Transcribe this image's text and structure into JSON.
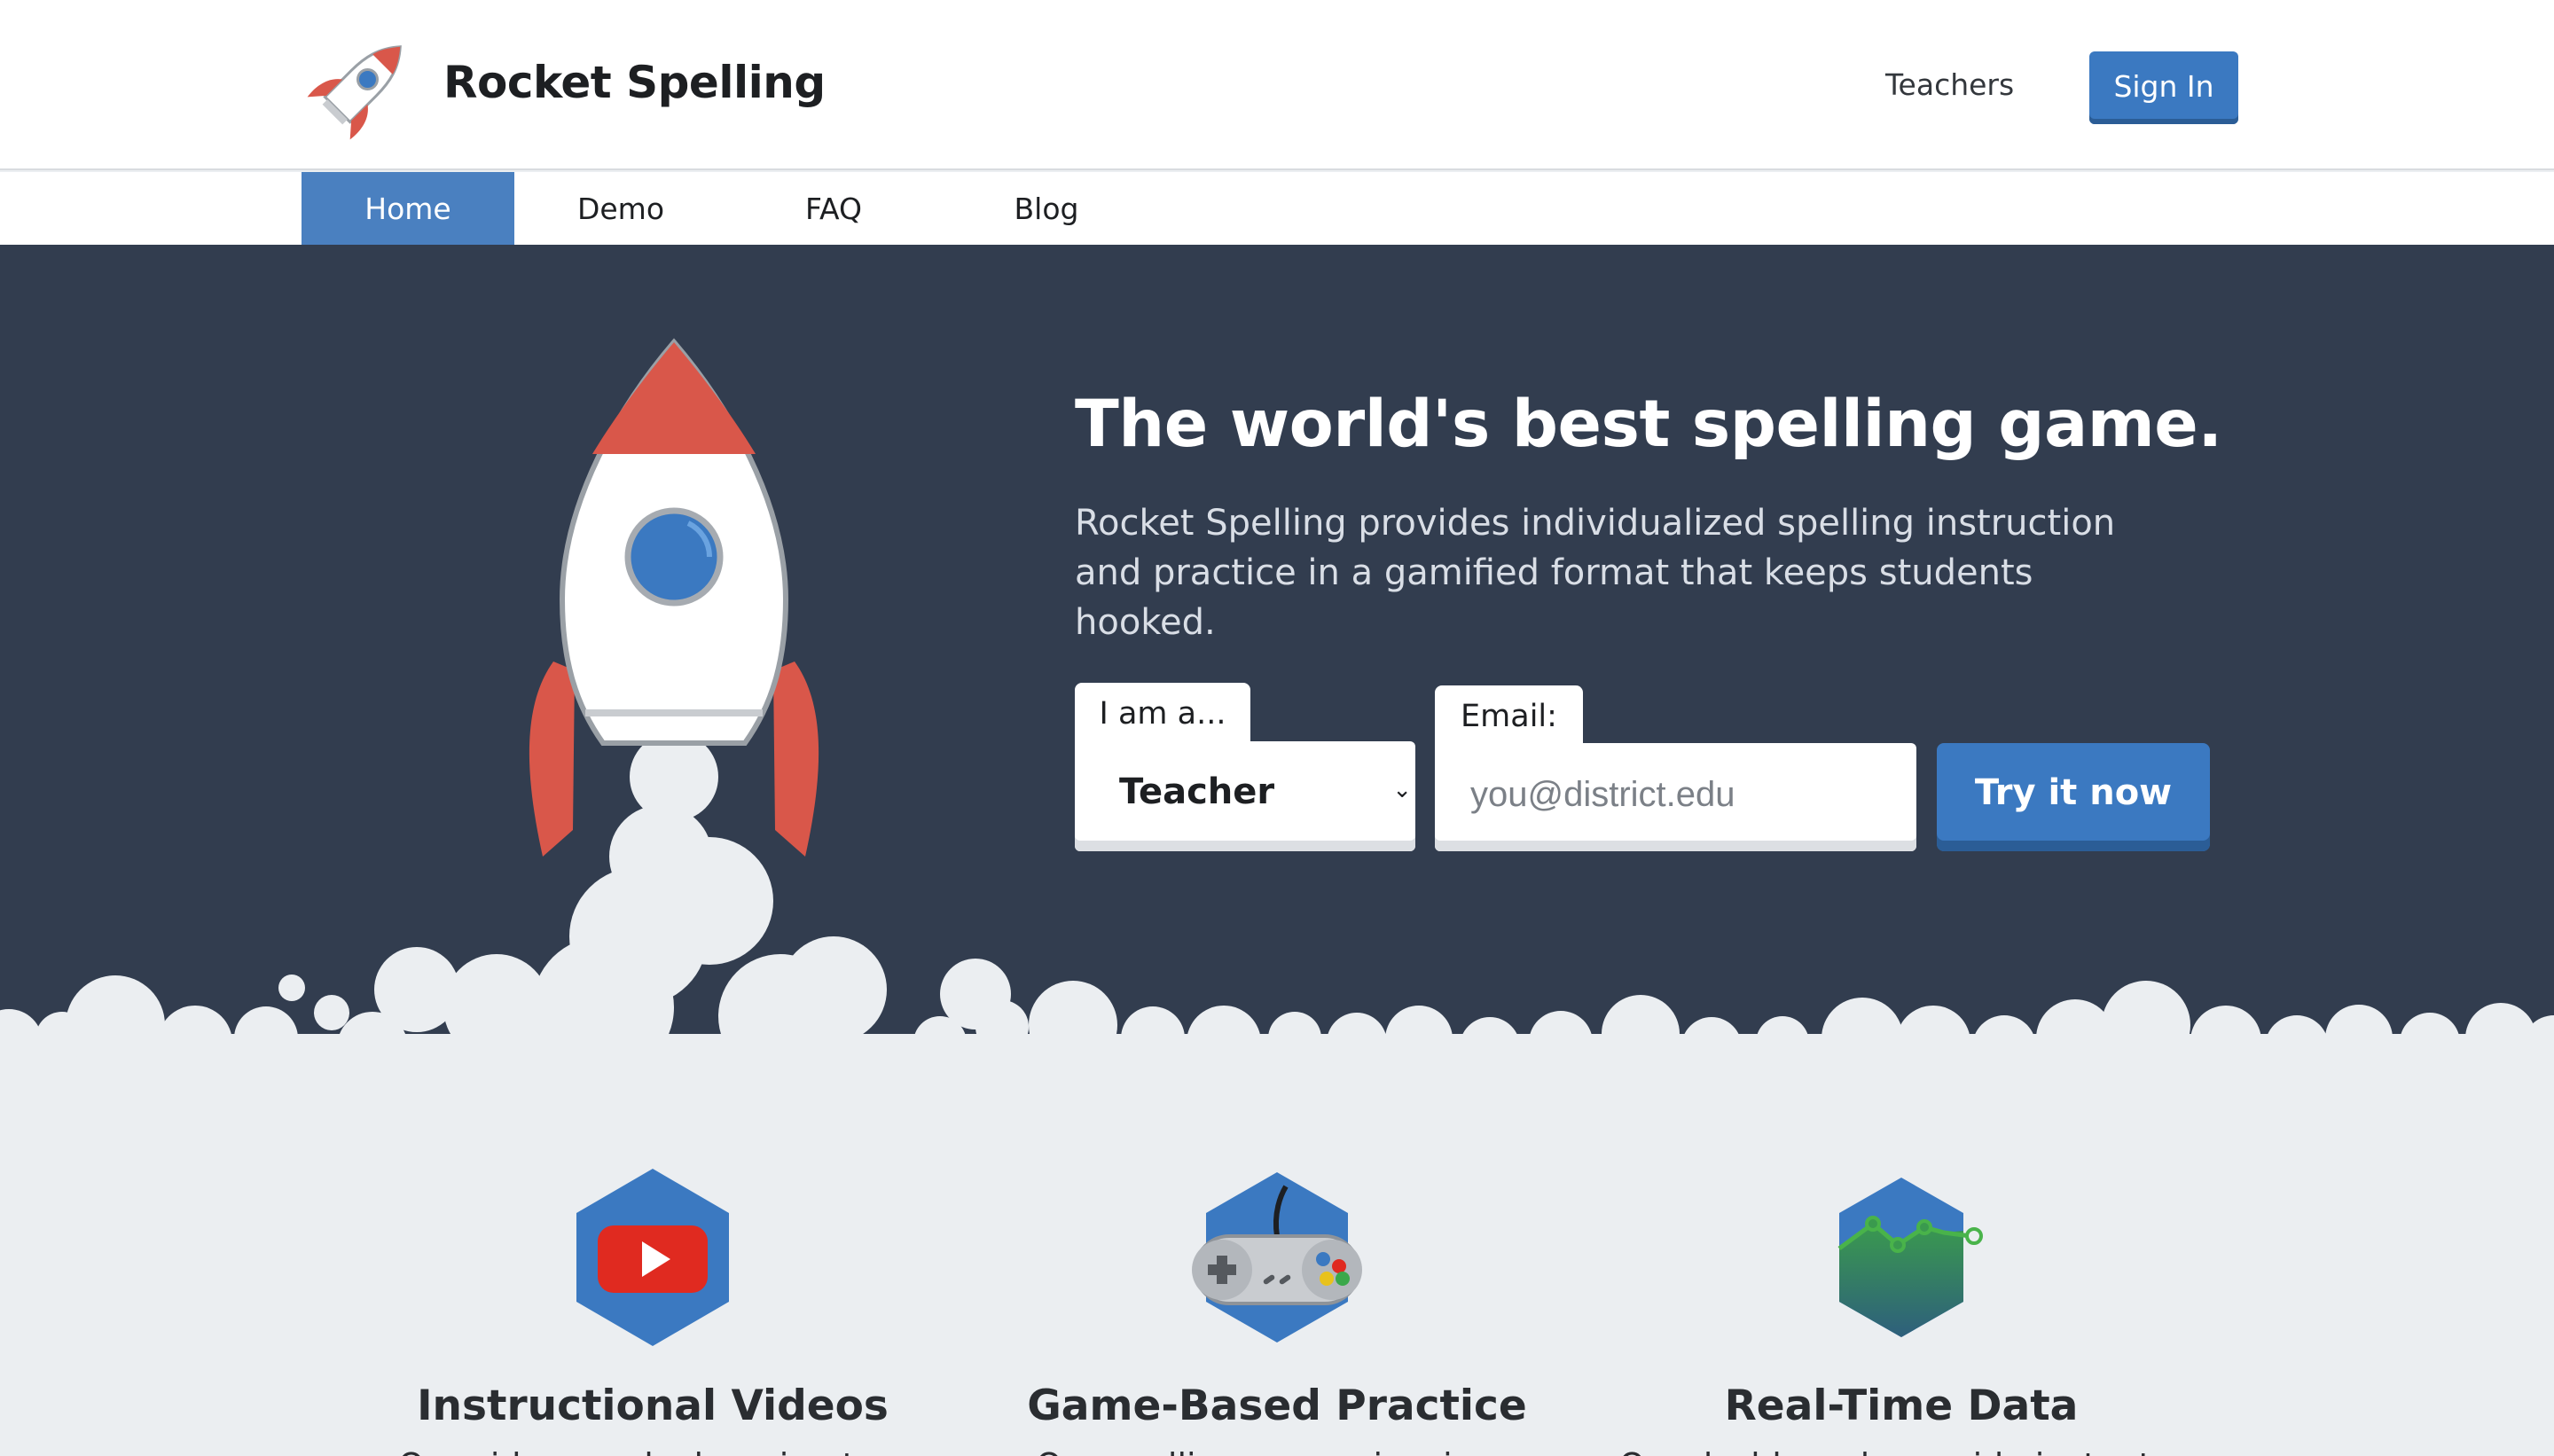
{
  "header": {
    "brand": "Rocket Spelling",
    "teachers_link": "Teachers",
    "signin_label": "Sign In"
  },
  "nav": {
    "items": [
      {
        "label": "Home",
        "active": true
      },
      {
        "label": "Demo",
        "active": false
      },
      {
        "label": "FAQ",
        "active": false
      },
      {
        "label": "Blog",
        "active": false
      }
    ]
  },
  "hero": {
    "headline": "The world's best spelling game.",
    "subtext": "Rocket Spelling provides individualized spelling instruction and practice in a gamified format that keeps students hooked.",
    "role_tab_label": "I am a...",
    "role_selected": "Teacher",
    "email_tab_label": "Email:",
    "email_placeholder": "you@district.edu",
    "cta_label": "Try it now"
  },
  "features": [
    {
      "title": "Instructional Videos",
      "desc": "Our videos make learning to...",
      "icon": "youtube-play-icon"
    },
    {
      "title": "Game-Based Practice",
      "desc": "Our spelling games inspire...",
      "icon": "game-controller-icon"
    },
    {
      "title": "Real-Time Data",
      "desc": "Our dashboards provide instant...",
      "icon": "line-chart-icon"
    }
  ],
  "colors": {
    "hero_bg": "#323d4f",
    "accent_blue": "#3b79c1",
    "rocket_red": "#d9574a",
    "cloud": "#ebeef1"
  }
}
